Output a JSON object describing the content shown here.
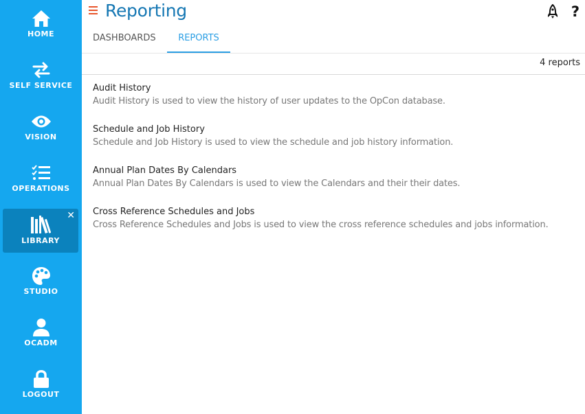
{
  "sidebar": {
    "items": [
      {
        "label": "HOME",
        "icon": "home-icon"
      },
      {
        "label": "SELF SERVICE",
        "icon": "swap-arrows-icon"
      },
      {
        "label": "VISION",
        "icon": "eye-icon"
      },
      {
        "label": "OPERATIONS",
        "icon": "checklist-icon"
      },
      {
        "label": "LIBRARY",
        "icon": "library-books-icon",
        "active": true,
        "close": "✕"
      },
      {
        "label": "STUDIO",
        "icon": "palette-icon"
      },
      {
        "label": "OCADM",
        "icon": "user-icon"
      },
      {
        "label": "LOGOUT",
        "icon": "lock-icon"
      }
    ]
  },
  "header": {
    "title": "Reporting",
    "help": "?"
  },
  "tabs": [
    {
      "label": "DASHBOARDS"
    },
    {
      "label": "REPORTS",
      "active": true
    }
  ],
  "report_count": "4 reports",
  "reports": [
    {
      "title": "Audit History",
      "description": "Audit History is used to view the history of user updates to the OpCon database."
    },
    {
      "title": "Schedule and Job History",
      "description": "Schedule and Job History is used to view the schedule and job history information."
    },
    {
      "title": "Annual Plan Dates By Calendars",
      "description": "Annual Plan Dates By Calendars is used to view the Calendars and their their dates."
    },
    {
      "title": "Cross Reference Schedules and Jobs",
      "description": "Cross Reference Schedules and Jobs is used to view the cross reference schedules and jobs information."
    }
  ],
  "colors": {
    "sidebar": "#15a7ef",
    "sidebar_active": "#0b82bd",
    "title": "#1577b3",
    "tab_active": "#2a9ee4",
    "hamburger": "#e8542a"
  }
}
